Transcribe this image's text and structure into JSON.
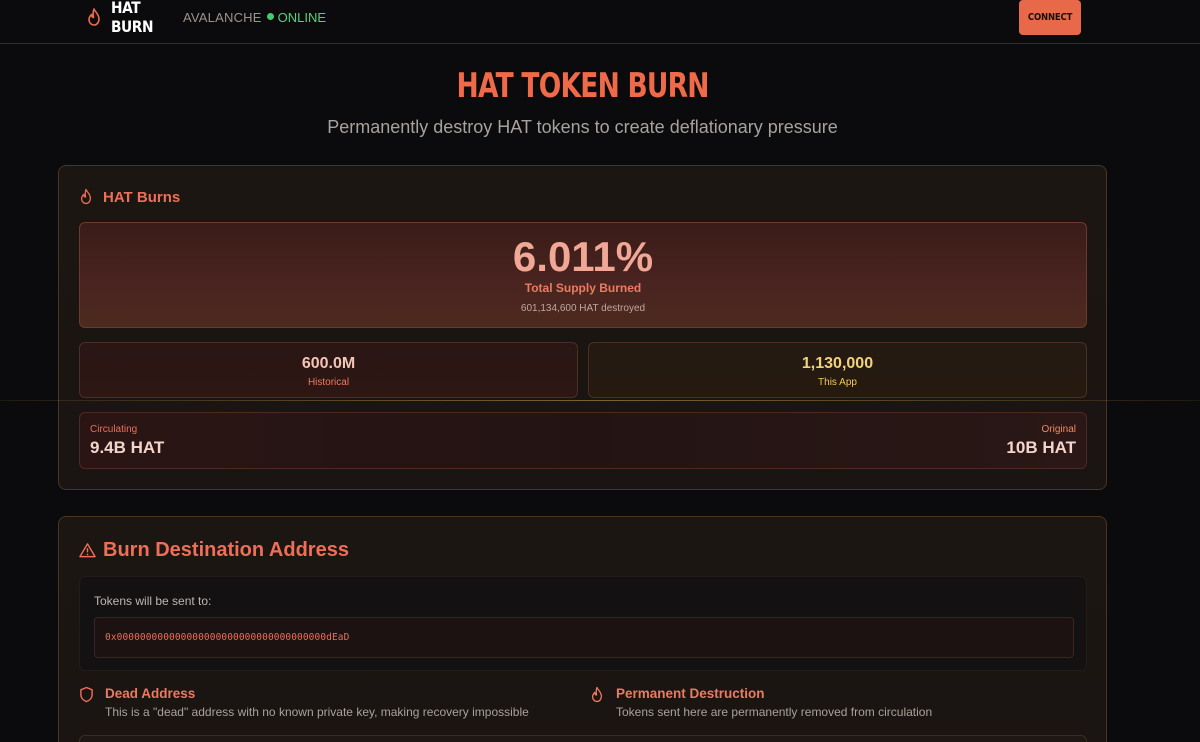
{
  "nav": {
    "brand": "HAT BURN",
    "network": "AVALANCHE",
    "status": "ONLINE",
    "connect_label": "CONNECT"
  },
  "hero": {
    "title": "HAT TOKEN BURN",
    "subtitle": "Permanently destroy HAT tokens to create deflationary pressure"
  },
  "burns": {
    "title": "HAT Burns",
    "percent": "6.011%",
    "percent_label": "Total Supply Burned",
    "destroyed": "601,134,600 HAT destroyed",
    "historical_value": "600.0M",
    "historical_label": "Historical",
    "app_value": "1,130,000",
    "app_label": "This App",
    "circulating_label": "Circulating",
    "circulating_value": "9.4B HAT",
    "original_label": "Original",
    "original_value": "10B HAT"
  },
  "destination": {
    "title": "Burn Destination Address",
    "sent_to_label": "Tokens will be sent to:",
    "address": "0x000000000000000000000000000000000000dEaD",
    "features": [
      {
        "title": "Dead Address",
        "desc": "This is a \"dead\" address with no known private key, making recovery impossible",
        "icon": "shield-icon"
      },
      {
        "title": "Permanent Destruction",
        "desc": "Tokens sent here are permanently removed from circulation",
        "icon": "flame-icon"
      }
    ]
  },
  "colors": {
    "accent": "#ee6a48",
    "online": "#4fd47c",
    "background": "#0b0a0c"
  }
}
